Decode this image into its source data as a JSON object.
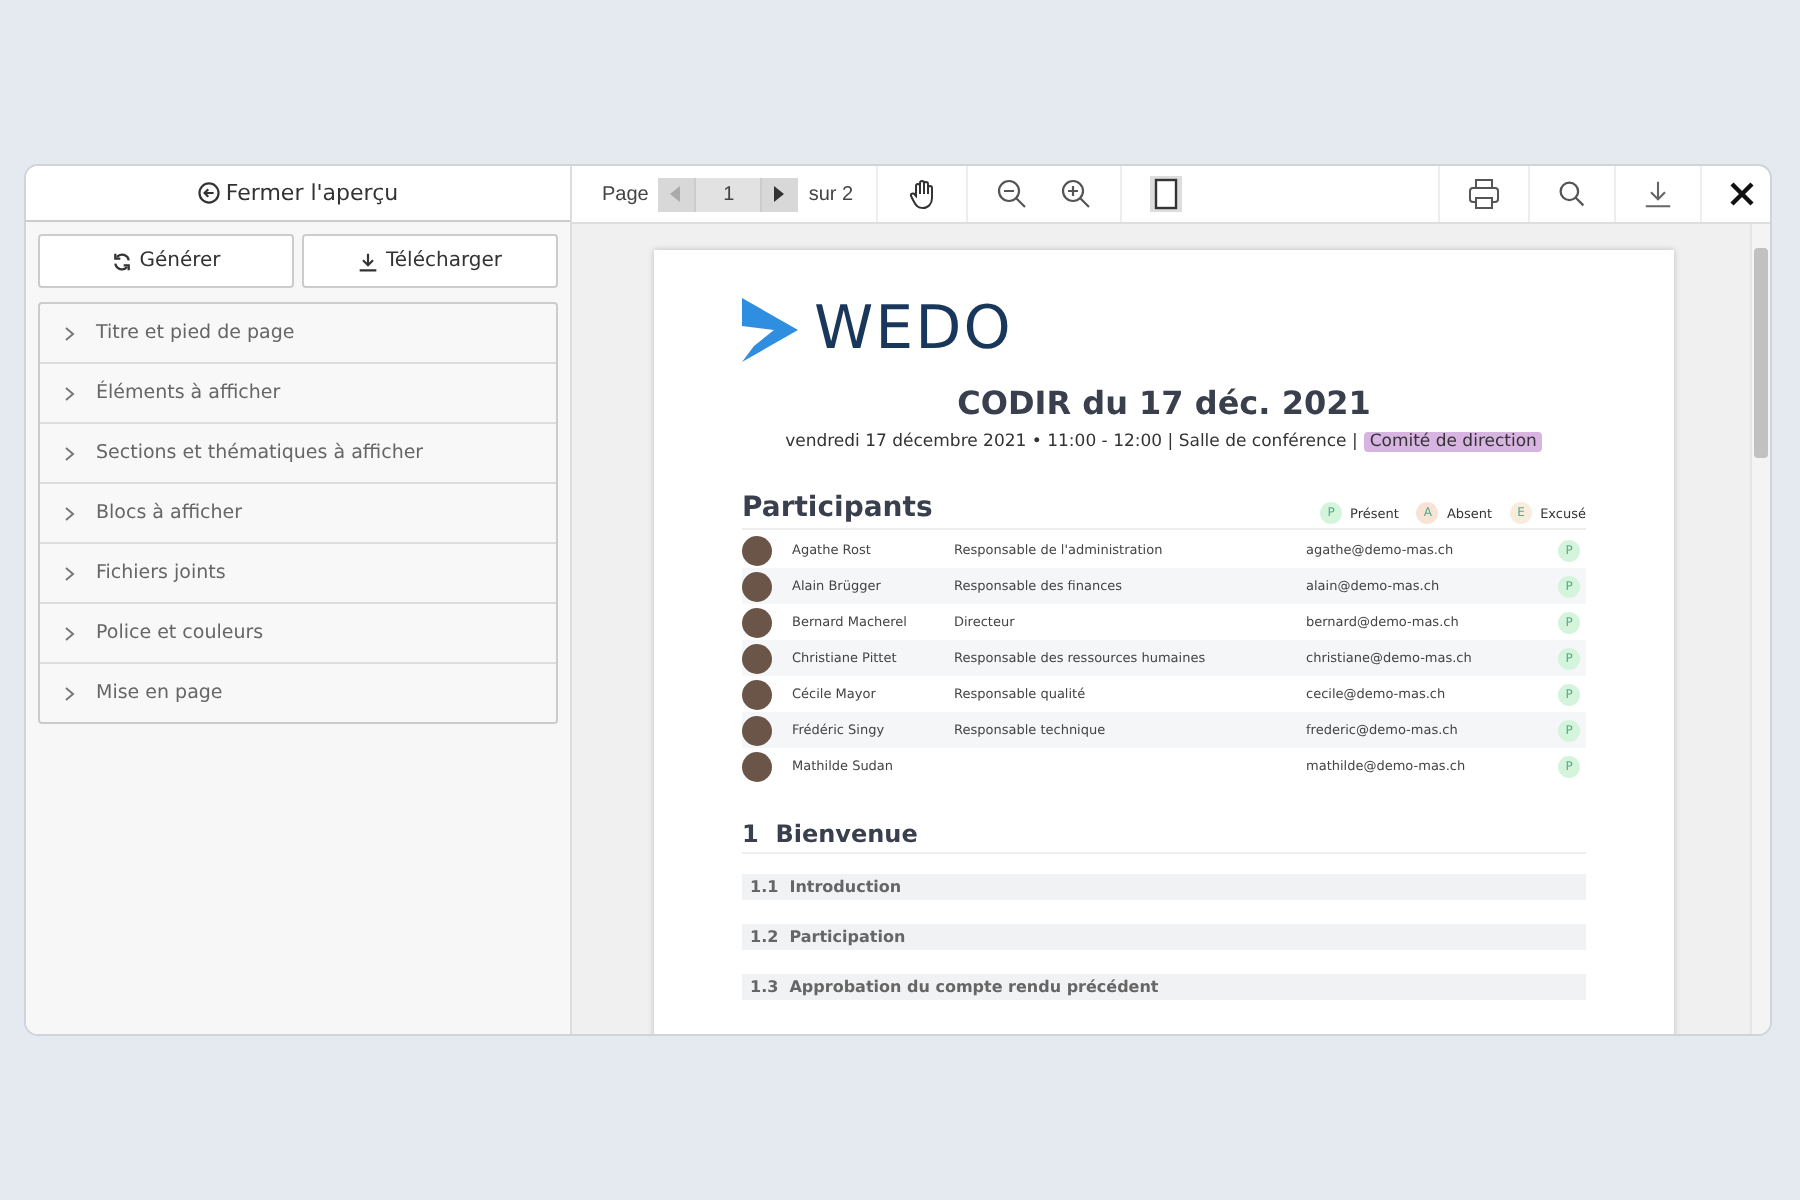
{
  "sidebar": {
    "close_label": "Fermer l'aperçu",
    "buttons": [
      {
        "kind": "refresh",
        "label": "Générer"
      },
      {
        "kind": "download",
        "label": "Télécharger"
      }
    ],
    "sections": [
      {
        "label": "Titre et pied de page",
        "expanded": false
      },
      {
        "label": "Éléments à afficher",
        "expanded": false
      },
      {
        "label": "Sections et thématiques à afficher",
        "expanded": false
      },
      {
        "label": "Blocs à afficher",
        "expanded": false
      },
      {
        "label": "Fichiers joints",
        "expanded": false
      },
      {
        "label": "Police et couleurs",
        "expanded": false
      },
      {
        "label": "Mise en page",
        "expanded": false
      }
    ]
  },
  "toolbar": {
    "page_label": "Page",
    "page": "1",
    "page_total": "sur 2"
  },
  "document": {
    "logo": "WEDO",
    "title": "CODIR du 17 déc. 2021",
    "subtitle": "vendredi 17 décembre 2021 • 11:00 - 12:00 | Salle de conférence |",
    "tag": "Comité de direction",
    "participants_heading": "Participants",
    "legend": [
      {
        "letter": "P",
        "label": "Présent",
        "color": "#d4f5dc"
      },
      {
        "letter": "A",
        "label": "Absent",
        "color": "#f8e3d4"
      },
      {
        "letter": "E",
        "label": "Excusé",
        "color": "#f8ecdc"
      }
    ],
    "participants": [
      {
        "name": "Agathe Rost",
        "role": "Responsable de l'administration",
        "email": "agathe@demo-mas.ch",
        "status": "P",
        "color": "#d4f5dc"
      },
      {
        "name": "Alain Brügger",
        "role": "Responsable des finances",
        "email": "alain@demo-mas.ch",
        "status": "P",
        "color": "#d4f5dc"
      },
      {
        "name": "Bernard Macherel",
        "role": "Directeur",
        "email": "bernard@demo-mas.ch",
        "status": "P",
        "color": "#d4f5dc"
      },
      {
        "name": "Christiane Pittet",
        "role": "Responsable des ressources humaines",
        "email": "christiane@demo-mas.ch",
        "status": "P",
        "color": "#d4f5dc"
      },
      {
        "name": "Cécile Mayor",
        "role": "Responsable qualité",
        "email": "cecile@demo-mas.ch",
        "status": "P",
        "color": "#d4f5dc"
      },
      {
        "name": "Frédéric Singy",
        "role": "Responsable technique",
        "email": "frederic@demo-mas.ch",
        "status": "P",
        "color": "#d4f5dc"
      },
      {
        "name": "Mathilde Sudan",
        "email": "mathilde@demo-mas.ch",
        "status": "P",
        "color": "#d4f5dc"
      }
    ],
    "section": {
      "number": "1",
      "title": "Bienvenue",
      "subsections": [
        {
          "number": "1.1",
          "title": "Introduction"
        },
        {
          "number": "1.2",
          "title": "Participation"
        },
        {
          "number": "1.3",
          "title": "Approbation du compte rendu précédent"
        }
      ]
    }
  }
}
